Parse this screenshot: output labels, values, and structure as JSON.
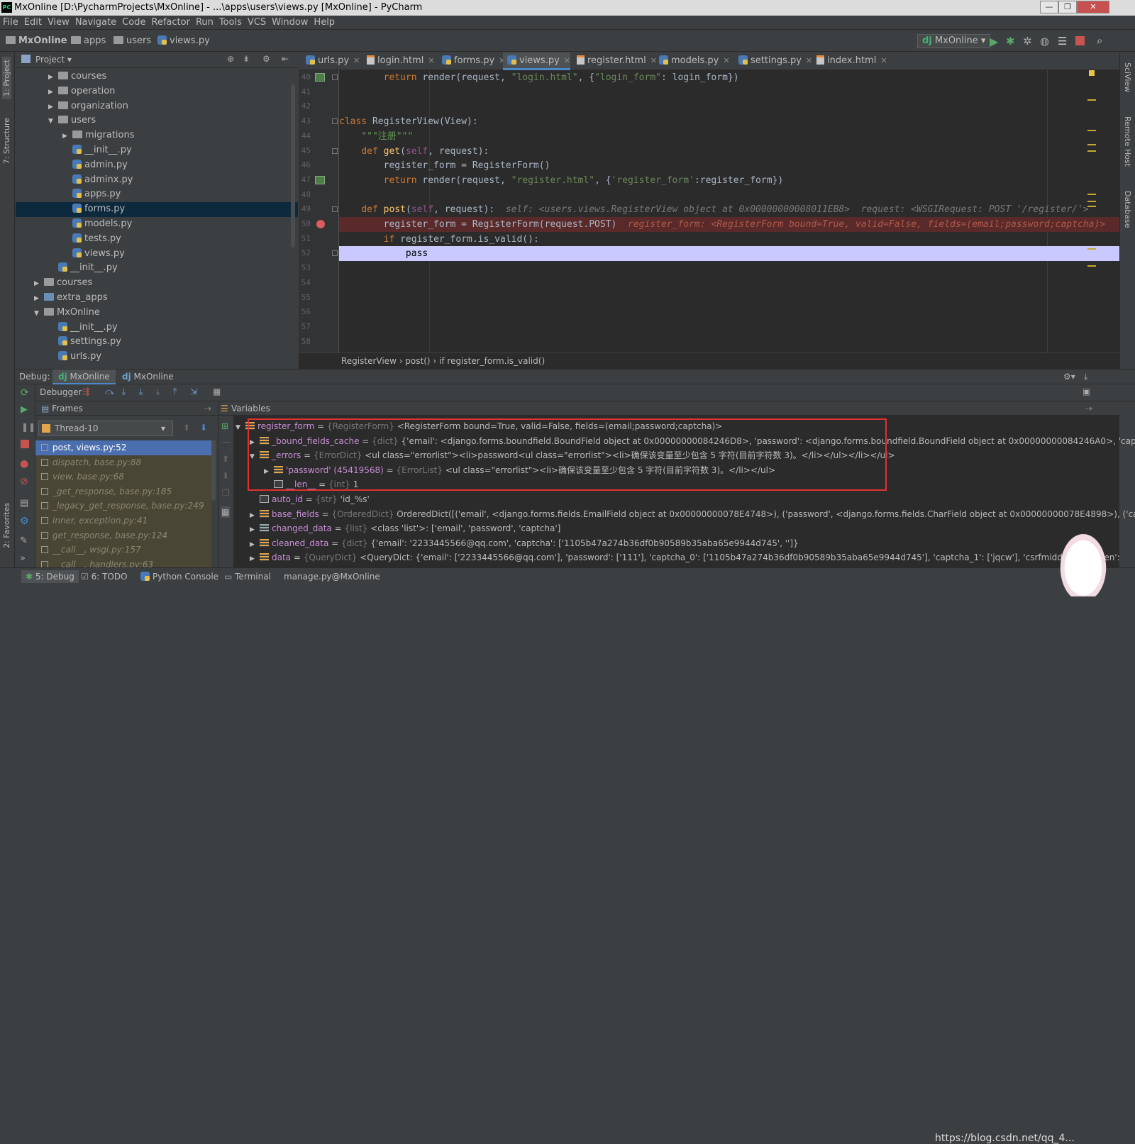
{
  "window": {
    "title": "MxOnline [D:\\PycharmProjects\\MxOnline] - ...\\apps\\users\\views.py [MxOnline] - PyCharm"
  },
  "menu": [
    "File",
    "Edit",
    "View",
    "Navigate",
    "Code",
    "Refactor",
    "Run",
    "Tools",
    "VCS",
    "Window",
    "Help"
  ],
  "nav": {
    "crumbs": [
      "MxOnline",
      "apps",
      "users",
      "views.py"
    ],
    "run_config": "MxOnline"
  },
  "left_tabs": [
    "1: Project",
    "7: Structure",
    "2: Favorites"
  ],
  "right_tabs": [
    "SciView",
    "Remote Host",
    "Database"
  ],
  "project": {
    "header": "Project",
    "tree": [
      {
        "label": "courses",
        "depth": 2,
        "type": "folder",
        "arrow": "▶"
      },
      {
        "label": "operation",
        "depth": 2,
        "type": "folder",
        "arrow": "▶"
      },
      {
        "label": "organization",
        "depth": 2,
        "type": "folder",
        "arrow": "▶"
      },
      {
        "label": "users",
        "depth": 2,
        "type": "folder",
        "arrow": "▼"
      },
      {
        "label": "migrations",
        "depth": 3,
        "type": "folder",
        "arrow": "▶"
      },
      {
        "label": "__init__.py",
        "depth": 3,
        "type": "py",
        "arrow": ""
      },
      {
        "label": "admin.py",
        "depth": 3,
        "type": "py",
        "arrow": ""
      },
      {
        "label": "adminx.py",
        "depth": 3,
        "type": "py",
        "arrow": ""
      },
      {
        "label": "apps.py",
        "depth": 3,
        "type": "py",
        "arrow": ""
      },
      {
        "label": "forms.py",
        "depth": 3,
        "type": "py",
        "arrow": "",
        "selected": true
      },
      {
        "label": "models.py",
        "depth": 3,
        "type": "py",
        "arrow": ""
      },
      {
        "label": "tests.py",
        "depth": 3,
        "type": "py",
        "arrow": ""
      },
      {
        "label": "views.py",
        "depth": 3,
        "type": "py",
        "arrow": ""
      },
      {
        "label": "__init__.py",
        "depth": 2,
        "type": "py",
        "arrow": ""
      },
      {
        "label": "courses",
        "depth": 1,
        "type": "folder",
        "arrow": "▶"
      },
      {
        "label": "extra_apps",
        "depth": 1,
        "type": "folder-blue",
        "arrow": "▶"
      },
      {
        "label": "MxOnline",
        "depth": 1,
        "type": "folder",
        "arrow": "▼"
      },
      {
        "label": "__init__.py",
        "depth": 2,
        "type": "py",
        "arrow": ""
      },
      {
        "label": "settings.py",
        "depth": 2,
        "type": "py",
        "arrow": ""
      },
      {
        "label": "urls.py",
        "depth": 2,
        "type": "py",
        "arrow": ""
      }
    ]
  },
  "editor": {
    "tabs": [
      {
        "label": "urls.py",
        "type": "py"
      },
      {
        "label": "login.html",
        "type": "html"
      },
      {
        "label": "forms.py",
        "type": "py"
      },
      {
        "label": "views.py",
        "type": "py",
        "active": true
      },
      {
        "label": "register.html",
        "type": "html"
      },
      {
        "label": "models.py",
        "type": "py"
      },
      {
        "label": "settings.py",
        "type": "py"
      },
      {
        "label": "index.html",
        "type": "html"
      }
    ],
    "line_numbers": [
      "40",
      "41",
      "42",
      "43",
      "44",
      "45",
      "46",
      "47",
      "48",
      "49",
      "50",
      "51",
      "52",
      "53",
      "54",
      "55",
      "56",
      "57",
      "58"
    ],
    "lines": [
      [
        {
          "t": "        ",
          "c": ""
        },
        {
          "t": "return ",
          "c": "kw"
        },
        {
          "t": "render(request, ",
          "c": ""
        },
        {
          "t": "\"login.html\"",
          "c": "str"
        },
        {
          "t": ", {",
          "c": ""
        },
        {
          "t": "\"login_form\"",
          "c": "str"
        },
        {
          "t": ": login_form})",
          "c": ""
        }
      ],
      [],
      [],
      [
        {
          "t": "class ",
          "c": "kw"
        },
        {
          "t": "RegisterView(View):",
          "c": ""
        }
      ],
      [
        {
          "t": "    ",
          "c": ""
        },
        {
          "t": "\"\"\"注册\"\"\"",
          "c": "cm"
        }
      ],
      [
        {
          "t": "    ",
          "c": ""
        },
        {
          "t": "def ",
          "c": "kw"
        },
        {
          "t": "get",
          "c": "fn"
        },
        {
          "t": "(",
          "c": ""
        },
        {
          "t": "self",
          "c": "self"
        },
        {
          "t": ", request):",
          "c": ""
        }
      ],
      [
        {
          "t": "        register_form = RegisterForm()",
          "c": ""
        }
      ],
      [
        {
          "t": "        ",
          "c": ""
        },
        {
          "t": "return ",
          "c": "kw"
        },
        {
          "t": "render(request, ",
          "c": ""
        },
        {
          "t": "\"register.html\"",
          "c": "str"
        },
        {
          "t": ", {",
          "c": ""
        },
        {
          "t": "'register_form'",
          "c": "str"
        },
        {
          "t": ":register_form})",
          "c": ""
        }
      ],
      [],
      [
        {
          "t": "    ",
          "c": ""
        },
        {
          "t": "def ",
          "c": "kw"
        },
        {
          "t": "post",
          "c": "fn"
        },
        {
          "t": "(",
          "c": ""
        },
        {
          "t": "self",
          "c": "self"
        },
        {
          "t": ", request):  ",
          "c": ""
        },
        {
          "t": "self: <users.views.RegisterView object at 0x00000000008011EB8>  request: <WSGIRequest: POST '/register/'>",
          "c": "hint"
        }
      ],
      [
        {
          "t": "        register_form = RegisterForm(request.POST)  ",
          "c": ""
        },
        {
          "t": "register_form: <RegisterForm bound=True, valid=False, fields=(email;password;captcha)>",
          "c": "hintr"
        }
      ],
      [
        {
          "t": "        ",
          "c": ""
        },
        {
          "t": "if ",
          "c": "kw"
        },
        {
          "t": "register_form.is_valid():",
          "c": ""
        }
      ],
      [
        {
          "t": "            pass",
          "c": ""
        }
      ],
      [],
      [],
      [],
      [],
      [],
      []
    ],
    "breadcrumbs": "RegisterView  ›  post()  ›  if register_form.is_valid()"
  },
  "debug": {
    "label": "Debug:",
    "tabs": [
      "MxOnline",
      "MxOnline"
    ],
    "debugger_label": "Debugger",
    "frames_label": "Frames",
    "variables_label": "Variables",
    "thread": "Thread-10",
    "frames": [
      "post, views.py:52",
      "dispatch, base.py:88",
      "view, base.py:68",
      "_get_response, base.py:185",
      "_legacy_get_response, base.py:249",
      "inner, exception.py:41",
      "get_response, base.py:124",
      "__call__, wsgi.py:157",
      "__call__, handlers.py:63"
    ],
    "variables": [
      {
        "arrow": "▼",
        "indent": 0,
        "icon": "obj",
        "name": "register_form",
        "type": "{RegisterForm}",
        "value": "<RegisterForm bound=True, valid=False, fields=(email;password;captcha)>"
      },
      {
        "arrow": "▶",
        "indent": 1,
        "icon": "obj",
        "name": "_bound_fields_cache",
        "type": "{dict}",
        "value": "{'email': <django.forms.boundfield.BoundField object at 0x00000000084246D8>, 'password': <django.forms.boundfield.BoundField object at 0x00000000084246A0>, 'captcha"
      },
      {
        "arrow": "▼",
        "indent": 1,
        "icon": "obj",
        "name": "_errors",
        "type": "{ErrorDict}",
        "value": "<ul class=\"errorlist\"><li>password<ul class=\"errorlist\"><li>确保该变量至少包含 5 字符(目前字符数 3)。</li></ul></li></ul>"
      },
      {
        "arrow": "▶",
        "indent": 2,
        "icon": "obj",
        "name": "'password' (45419568)",
        "type": "{ErrorList}",
        "value": "<ul class=\"errorlist\"><li>确保该变量至少包含 5 字符(目前字符数 3)。</li></ul>"
      },
      {
        "arrow": "",
        "indent": 2,
        "icon": "num",
        "name": "__len__",
        "type": "{int}",
        "value": "1"
      },
      {
        "arrow": "",
        "indent": 1,
        "icon": "num",
        "name": "auto_id",
        "type": "{str}",
        "value": "'id_%s'"
      },
      {
        "arrow": "▶",
        "indent": 1,
        "icon": "obj",
        "name": "base_fields",
        "type": "{OrderedDict}",
        "value": "OrderedDict([('email', <django.forms.fields.EmailField object at 0x00000000078E4748>), ('password', <django.forms.fields.CharField object at 0x00000000078E4898>), ('captcl"
      },
      {
        "arrow": "▶",
        "indent": 1,
        "icon": "list",
        "name": "changed_data",
        "type": "{list}",
        "value": "<class 'list'>: ['email', 'password', 'captcha']"
      },
      {
        "arrow": "▶",
        "indent": 1,
        "icon": "obj",
        "name": "cleaned_data",
        "type": "{dict}",
        "value": "{'email': '2233445566@qq.com', 'captcha': ['1105b47a274b36df0b90589b35aba65e9944d745', '']}"
      },
      {
        "arrow": "▶",
        "indent": 1,
        "icon": "obj",
        "name": "data",
        "type": "{QueryDict}",
        "value": "<QueryDict: {'email': ['2233445566@qq.com'], 'password': ['111'], 'captcha_0': ['1105b47a274b36df0b90589b35aba65e9944d745'], 'captcha_1': ['jqcw'], 'csrfmiddlewaretoken':"
      }
    ]
  },
  "statusbar": {
    "tabs": [
      "5: Debug",
      "6: TODO",
      "Python Console",
      "Terminal",
      "manage.py@MxOnline"
    ]
  },
  "watermark": "https://blog.csdn.net/qq_4..."
}
